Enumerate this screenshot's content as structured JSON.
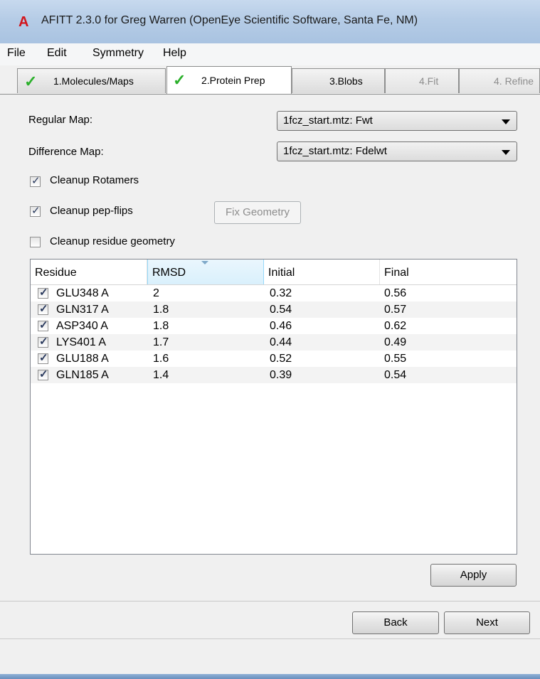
{
  "window": {
    "title": "AFITT 2.3.0 for Greg Warren (OpenEye Scientific Software, Santa Fe, NM)",
    "app_icon_glyph": "A",
    "app_icon_color": "#d2141b"
  },
  "menu": [
    "File",
    "Edit",
    "Symmetry",
    "Help"
  ],
  "tabs": [
    {
      "label": "1.Molecules/Maps",
      "checked": true
    },
    {
      "label": "2.Protein Prep",
      "checked": true,
      "active": true
    },
    {
      "label": "3.Blobs"
    },
    {
      "label": "4.Fit",
      "disabled": true
    },
    {
      "label": "4. Refine",
      "disabled": true
    }
  ],
  "form": {
    "regular_map_label": "Regular Map:",
    "regular_map_value": "1fcz_start.mtz: Fwt",
    "difference_map_label": "Difference Map:",
    "difference_map_value": "1fcz_start.mtz: Fdelwt",
    "cleanup_rotamers_label": "Cleanup Rotamers",
    "cleanup_rotamers_checked": true,
    "cleanup_pepflips_label": "Cleanup pep-flips",
    "cleanup_pepflips_checked": true,
    "fix_geometry_label": "Fix Geometry",
    "cleanup_geometry_label": "Cleanup residue geometry",
    "cleanup_geometry_checked": false
  },
  "table": {
    "columns": [
      "Residue",
      "RMSD",
      "Initial",
      "Final"
    ],
    "sorted_column": "RMSD",
    "rows": [
      {
        "residue": "GLU348 A",
        "rmsd": "2",
        "initial": "0.32",
        "final": "0.56",
        "checked": true
      },
      {
        "residue": "GLN317 A",
        "rmsd": "1.8",
        "initial": "0.54",
        "final": "0.57",
        "checked": true
      },
      {
        "residue": "ASP340 A",
        "rmsd": "1.8",
        "initial": "0.46",
        "final": "0.62",
        "checked": true
      },
      {
        "residue": "LYS401 A",
        "rmsd": "1.7",
        "initial": "0.44",
        "final": "0.49",
        "checked": true
      },
      {
        "residue": "GLU188 A",
        "rmsd": "1.6",
        "initial": "0.52",
        "final": "0.55",
        "checked": true
      },
      {
        "residue": "GLN185 A",
        "rmsd": "1.4",
        "initial": "0.39",
        "final": "0.54",
        "checked": true
      }
    ]
  },
  "buttons": {
    "apply": "Apply",
    "back": "Back",
    "next": "Next"
  },
  "colors": {
    "check_green": "#2bb02b",
    "titlebar": "#b5cce6"
  }
}
